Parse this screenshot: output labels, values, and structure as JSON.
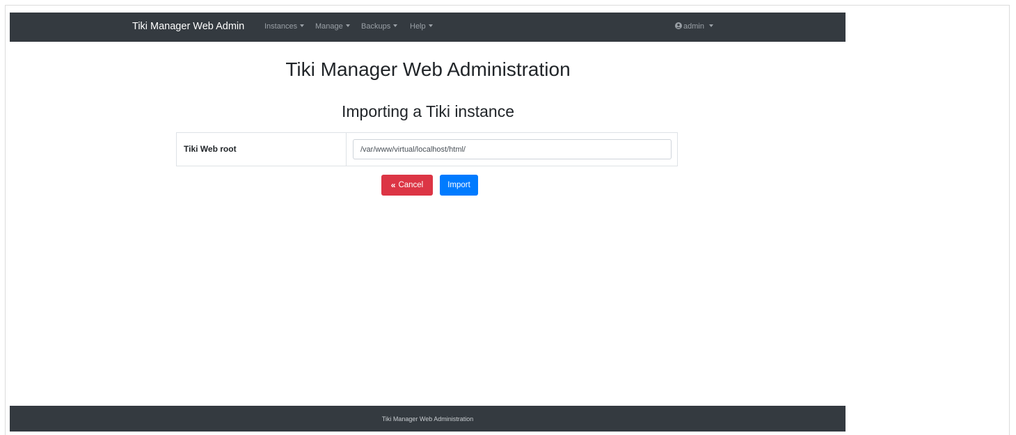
{
  "navbar": {
    "brand": "Tiki Manager Web Admin",
    "menus": [
      {
        "label": "Instances"
      },
      {
        "label": "Manage"
      },
      {
        "label": "Backups"
      },
      {
        "label": "Help"
      }
    ],
    "user": {
      "icon": "user-circle-icon",
      "label": "admin"
    }
  },
  "main": {
    "title": "Tiki Manager Web Administration",
    "subtitle": "Importing a Tiki instance",
    "form": {
      "label": "Tiki Web root",
      "value": "/var/www/virtual/localhost/html/"
    },
    "buttons": {
      "cancel": {
        "icon": "double-chevron-left-icon",
        "label": "Cancel",
        "color": "#dc3545"
      },
      "import": {
        "label": "Import",
        "color": "#007bff"
      }
    }
  },
  "footer": {
    "text": "Tiki Manager Web Administration"
  },
  "colors": {
    "navbar_bg": "#343a40",
    "danger": "#dc3545",
    "primary": "#007bff"
  }
}
